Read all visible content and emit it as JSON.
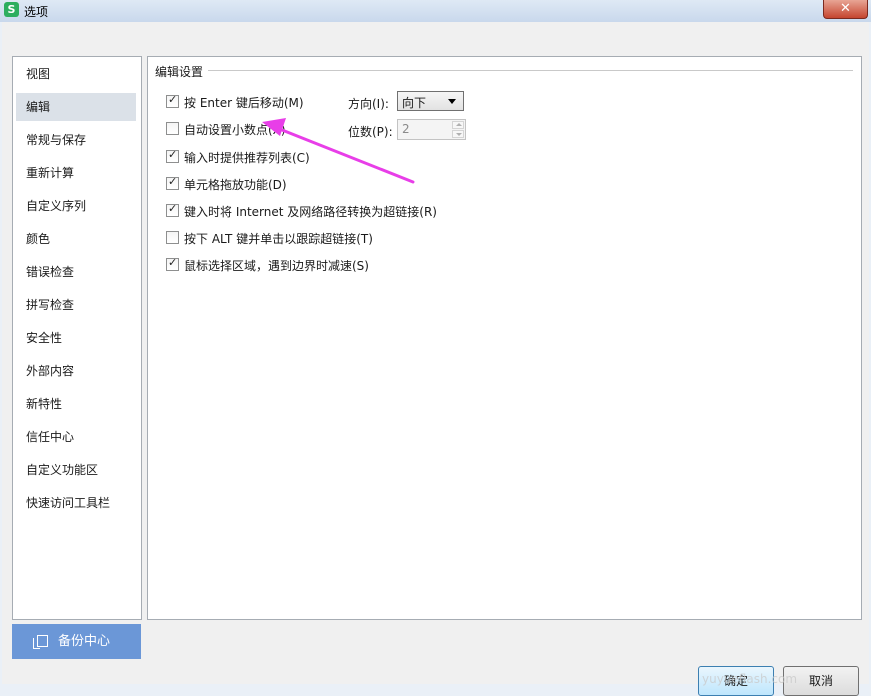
{
  "window": {
    "title": "选项",
    "app_icon_letter": "S",
    "close_glyph": "✕"
  },
  "sidebar": {
    "items": [
      {
        "label": "视图"
      },
      {
        "label": "编辑",
        "selected": true
      },
      {
        "label": "常规与保存"
      },
      {
        "label": "重新计算"
      },
      {
        "label": "自定义序列"
      },
      {
        "label": "颜色"
      },
      {
        "label": "错误检查"
      },
      {
        "label": "拼写检查"
      },
      {
        "label": "安全性"
      },
      {
        "label": "外部内容"
      },
      {
        "label": "新特性"
      },
      {
        "label": "信任中心"
      },
      {
        "label": "自定义功能区"
      },
      {
        "label": "快速访问工具栏"
      }
    ],
    "backup_button": "备份中心"
  },
  "edit_settings": {
    "group_title": "编辑设置",
    "options": [
      {
        "label": "按 Enter 键后移动(M)",
        "checked": true
      },
      {
        "label": "自动设置小数点(X)",
        "checked": false
      },
      {
        "label": "输入时提供推荐列表(C)",
        "checked": true
      },
      {
        "label": "单元格拖放功能(D)",
        "checked": true
      },
      {
        "label": "键入时将 Internet 及网络路径转换为超链接(R)",
        "checked": true
      },
      {
        "label": "按下 ALT 键并单击以跟踪超链接(T)",
        "checked": false
      },
      {
        "label": "鼠标选择区域，遇到边界时减速(S)",
        "checked": true
      }
    ],
    "direction": {
      "label": "方向(I):",
      "value": "向下"
    },
    "decimal_places": {
      "label": "位数(P):",
      "value": "2"
    }
  },
  "footer": {
    "ok_button": "确定",
    "cancel_button": "取消",
    "watermark": "yuyueflash.com"
  },
  "annotation": {
    "arrow_color": "#e83ee8"
  },
  "colors": {
    "accent": "#6b97d7",
    "nav_selected": "#dbe1e8"
  }
}
